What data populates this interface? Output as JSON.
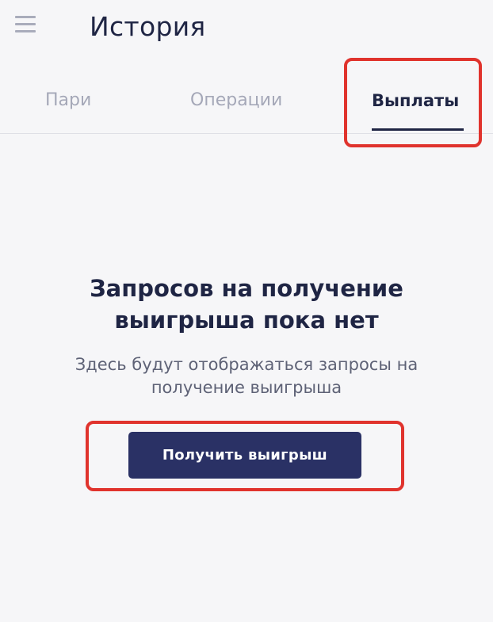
{
  "header": {
    "menu_icon": "hamburger-menu-icon",
    "title": "История"
  },
  "tabs": [
    {
      "label": "Пари",
      "active": false
    },
    {
      "label": "Операции",
      "active": false
    },
    {
      "label": "Выплаты",
      "active": true
    }
  ],
  "empty_state": {
    "title_line1": "Запросов на получение",
    "title_line2": "выигрыша пока нет",
    "subtitle_line1": "Здесь будут отображаться запросы на",
    "subtitle_line2": "получение выигрыша",
    "button_label": "Получить выигрыш"
  },
  "colors": {
    "background": "#f6f6f8",
    "primary": "#2a3165",
    "text_dark": "#1f2544",
    "text_muted": "#a5a8b8",
    "highlight": "#e0332d"
  }
}
